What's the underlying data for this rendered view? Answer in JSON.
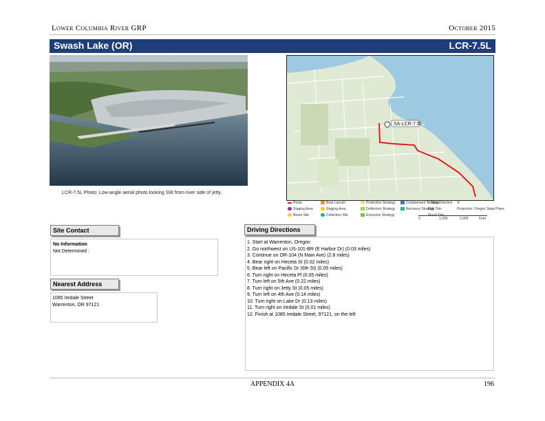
{
  "header": {
    "left": "Lower Columbia River GRP",
    "right": "October 2015"
  },
  "title_bar": {
    "title": "Swash Lake (OR)",
    "code": "LCR-7.5L"
  },
  "photo": {
    "caption": "LCR-7.5L Photo: Low-angle aerial photo looking SW from river side of jetty."
  },
  "map": {
    "site_label": "SA-LCR-7.5L",
    "legend": {
      "items": [
        "Route",
        "Staging Area",
        "Boom Site",
        "Boat Launch",
        "Staging Area",
        "Collection Site",
        "Protection Strategy",
        "Deflection Strategy",
        "Exclusion Strategy",
        "Containment Strategy",
        "Recovery Strategy",
        "Tidal Direction",
        "Ebb Tide",
        "Flood Tide"
      ],
      "scale": [
        "0",
        "1,000",
        "2,000",
        "Feet"
      ],
      "datum": "Projection: Oregon State Plane",
      "colors": {
        "route": "#e41a1c",
        "water": "#9ecae1",
        "land": "#dfe9d3"
      }
    }
  },
  "site_contact": {
    "label": "Site Contact",
    "name": "No Information",
    "detail": "Not Determined :"
  },
  "nearest_address": {
    "label": "Nearest Address",
    "line1": "1085 Iredale Street",
    "line2": "Warrenton, OR 97121"
  },
  "driving_directions": {
    "label": "Driving Directions",
    "steps": [
      "1. Start at Warrenton, Oregon",
      "2. Go northwest on US-101-BR (E Harbor Dr) (0.03 miles)",
      "3. Continue on OR-104 (N Main Ave) (2.8 miles)",
      "4. Bear right on Heceta St (0.02 miles)",
      "5. Bear left on Pacific Dr (6th St) (0.05 miles)",
      "6. Turn right on Heceta Pl (0.05 miles)",
      "7. Turn left on 5th Ave (0.22 miles)",
      "8. Turn right on Jetty St (0.05 miles)",
      "9. Turn left on 4th Ave (0.14 miles)",
      "10. Turn right on Lake Dr (0.13 miles)",
      "11. Turn right on Iredale St (0.01 miles)",
      "12. Finish at 1085 Iredale Street, 97121, on the left"
    ]
  },
  "footer": {
    "center": "APPENDIX 4A",
    "page": "196"
  }
}
